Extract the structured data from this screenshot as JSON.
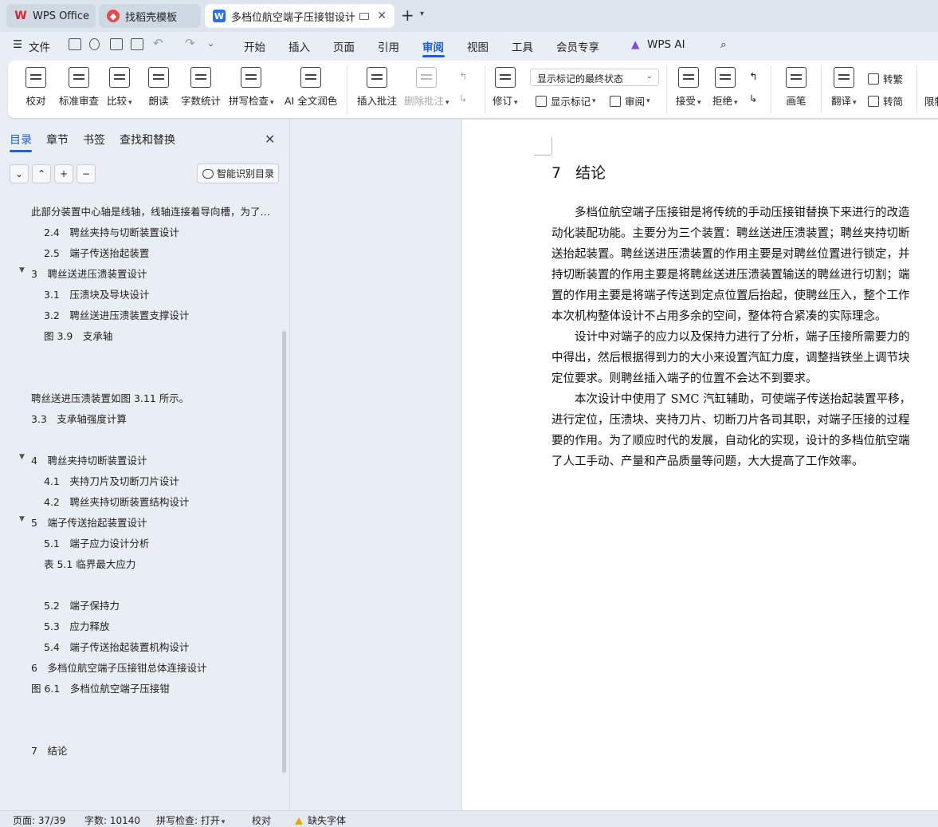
{
  "titlebar": {
    "tabs": [
      {
        "label": "WPS Office"
      },
      {
        "label": "找稻壳模板"
      },
      {
        "label": "多档位航空端子压接钳设计 论文"
      }
    ]
  },
  "menubar": {
    "file": "文件",
    "items": [
      "开始",
      "插入",
      "页面",
      "引用",
      "审阅",
      "视图",
      "工具",
      "会员专享",
      "WPS AI"
    ],
    "active": "审阅"
  },
  "ribbon": {
    "proofread": "校对",
    "standard_review": "标准审查",
    "compare": "比较",
    "read_aloud": "朗读",
    "word_count": "字数统计",
    "spell_check": "拼写检查",
    "ai_polish": "AI 全文润色",
    "insert_comment": "插入批注",
    "delete_comment": "删除批注",
    "track_changes": "修订",
    "markup_mode": "显示标记的最终状态",
    "show_markup": "显示标记",
    "review": "审阅",
    "accept": "接受",
    "reject": "拒绝",
    "ink": "画笔",
    "translate": "翻译",
    "to_traditional": "转繁",
    "to_simplified": "转简",
    "restrict": "限制"
  },
  "nav": {
    "tabs": [
      "目录",
      "章节",
      "书签",
      "查找和替换"
    ],
    "smart_toc": "智能识别目录",
    "toc": [
      {
        "text": "此部分装置中心轴是线轴，线轴连接着导向槽，为了固定的滑块在线轴上能够平稳移动",
        "level": 0,
        "expanded": true
      },
      {
        "text": "2.4　聘丝夹持与切断装置设计",
        "level": 1
      },
      {
        "text": "2.5　端子传送抬起装置",
        "level": 1
      },
      {
        "text": "3　聘丝送进压溃装置设计",
        "level": 0,
        "expanded": true
      },
      {
        "text": "3.1　压溃块及导块设计",
        "level": 1
      },
      {
        "text": "3.2　聘丝送进压溃装置支撑设计",
        "level": 1
      },
      {
        "text": "图 3.9　支承轴",
        "level": 1
      },
      {
        "text": "聘丝送进压溃装置如图 3.11 所示。",
        "level": 0
      },
      {
        "text": "3.3　支承轴强度计算",
        "level": 0
      },
      {
        "text": "4　聘丝夹持切断装置设计",
        "level": 0,
        "expanded": true
      },
      {
        "text": "4.1　夹持刀片及切断刀片设计",
        "level": 1
      },
      {
        "text": "4.2　聘丝夹持切断装置结构设计",
        "level": 1
      },
      {
        "text": "5　端子传送抬起装置设计",
        "level": 0,
        "expanded": true
      },
      {
        "text": "5.1　端子应力设计分析",
        "level": 1
      },
      {
        "text": "表 5.1 临界最大应力",
        "level": 1
      },
      {
        "text": "5.2　端子保持力",
        "level": 1
      },
      {
        "text": "5.3　应力释放",
        "level": 1
      },
      {
        "text": "5.4　端子传送抬起装置机构设计",
        "level": 1
      },
      {
        "text": "6　多档位航空端子压接钳总体连接设计",
        "level": 0
      },
      {
        "text": "图 6.1　多档位航空端子压接钳",
        "level": 0
      },
      {
        "text": "7　结论",
        "level": 0
      }
    ]
  },
  "doc": {
    "heading_num": "7",
    "heading_text": "结论",
    "paragraphs": [
      [
        "　　多档位航空端子压接钳是将传统的手动压接钳替换下来进行的改造",
        "动化装配功能。主要分为三个装置：聘丝送进压溃装置；聘丝夹持切断",
        "送抬起装置。聘丝送进压溃装置的作用主要是对聘丝位置进行锁定，并",
        "持切断装置的作用主要是将聘丝送进压溃装置输送的聘丝进行切割；端",
        "置的作用主要是将端子传送到定点位置后抬起，使聘丝压入，整个工作",
        "本次机构整体设计不占用多余的空间，整体符合紧凑的实际理念。"
      ],
      [
        "　　设计中对端子的应力以及保持力进行了分析，端子压接所需要力的",
        "中得出，然后根据得到力的大小来设置汽缸力度，调整挡铁坐上调节块",
        "定位要求。则聘丝插入端子的位置不会达不到要求。"
      ],
      [
        "　　本次设计中使用了 SMC 汽缸辅助，可使端子传送抬起装置平移，",
        "进行定位，压溃块、夹持刀片、切断刀片各司其职，对端子压接的过程",
        "要的作用。为了顺应时代的发展，自动化的实现，设计的多档位航空端",
        "了人工手动、产量和产品质量等问题，大大提高了工作效率。"
      ]
    ]
  },
  "status": {
    "page": "页面: 37/39",
    "words": "字数: 10140",
    "spell": "拼写检查: 打开",
    "proof": "校对",
    "missing_font": "缺失字体"
  },
  "colors": {
    "accent": "#1f5fd6",
    "wps_red": "#d9262c",
    "doc_blue": "#2b6ee8",
    "warning": "#e7a400"
  }
}
